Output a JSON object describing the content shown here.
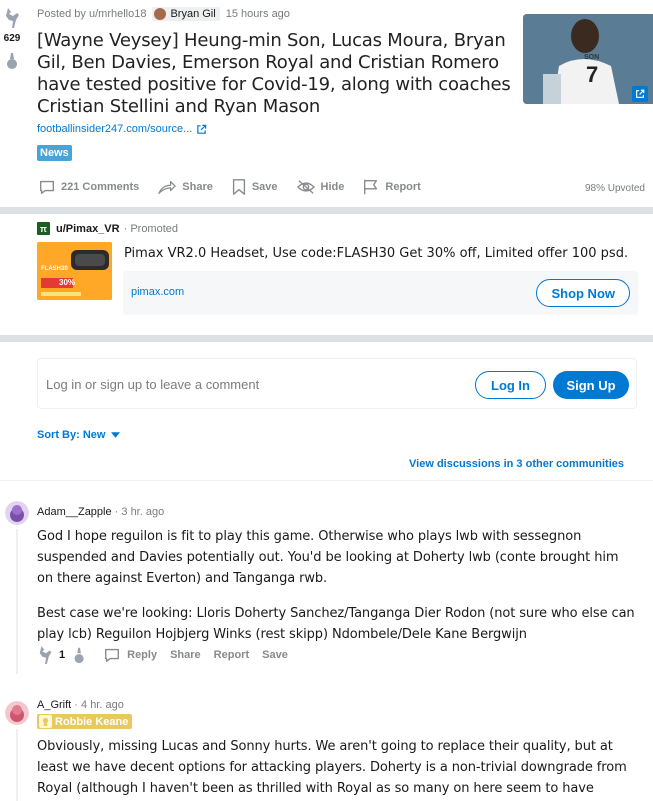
{
  "post": {
    "score": "629",
    "posted_by": "Posted by u/mrhello18",
    "user_flair": "Bryan Gil",
    "time": "15 hours ago",
    "title": "[Wayne Veysey] Heung-min Son, Lucas Moura, Bryan Gil, Ben Davies, Emerson Royal and Cristian Romero have tested positive for Covid-19, along with coaches Cristian Stellini and Ryan Mason",
    "link_text": "footballinsider247.com/source...",
    "tag": "News",
    "actions": {
      "comments": "221 Comments",
      "share": "Share",
      "save": "Save",
      "hide": "Hide",
      "report": "Report"
    },
    "upvoted": "98% Upvoted",
    "thumbnail_text": {
      "name": "SON",
      "number": "7"
    }
  },
  "promo": {
    "user": "u/Pimax_VR",
    "promoted": "· Promoted",
    "text": "Pimax VR2.0 Headset, Use code:FLASH30 Get 30% off, Limited offer 100 psd.",
    "domain": "pimax.com",
    "cta": "Shop Now",
    "image_text": {
      "code": "FLASH30",
      "off": "30%"
    }
  },
  "comment_box": {
    "prompt": "Log in or sign up to leave a comment",
    "login": "Log In",
    "signup": "Sign Up"
  },
  "sort": {
    "label": "Sort By: New"
  },
  "view_discussions": "View discussions in 3 other communities",
  "comments": [
    {
      "author": "Adam__Zapple",
      "time": "· 3 hr. ago",
      "paragraphs": [
        "God I hope reguilon is fit to play this game. Otherwise who plays lwb with sessegnon suspended and Davies potentially out. You'd be looking at Doherty lwb (conte brought him on there against Everton) and Tanganga rwb.",
        "Best case we're looking: Lloris Doherty Sanchez/Tanganga Dier Rodon (not sure who else can play lcb) Reguilon Hojbjerg Winks (rest skipp) Ndombele/Dele Kane Bergwijn"
      ],
      "score": "1",
      "reply": "Reply",
      "share": "Share",
      "report": "Report",
      "save": "Save"
    },
    {
      "author": "A_Grift",
      "time": "· 4 hr. ago",
      "flair": "Robbie Keane",
      "paragraphs": [
        "Obviously, missing Lucas and Sonny hurts. We aren't going to replace their quality, but at least we have decent options for attacking players. Doherty is a non-trivial downgrade from Royal (although I haven't been as thrilled with Royal as so many on here seem to have been)."
      ]
    }
  ],
  "colors": {
    "accent": "#0079d3",
    "divider": "#dae0e6",
    "news_tag": "#46a4d8",
    "flair_gold": "#e8c95d"
  }
}
